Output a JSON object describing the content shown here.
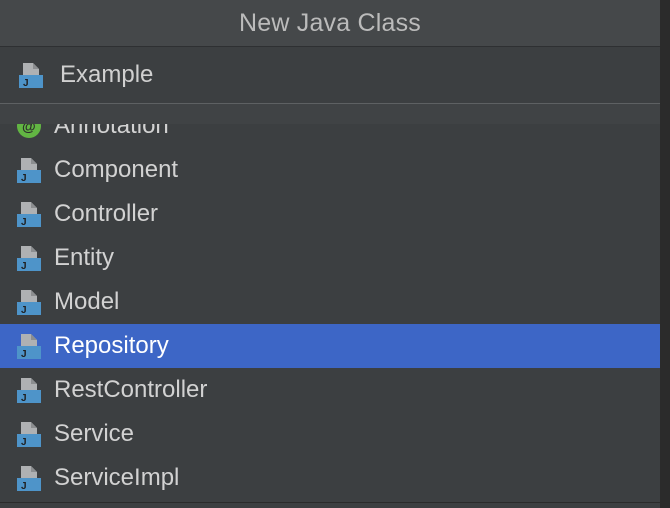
{
  "dialog": {
    "title": "New Java Class"
  },
  "name_field": {
    "value": "Example",
    "icon": "java-class-icon"
  },
  "template_list": {
    "items": [
      {
        "label": "Annotation",
        "icon": "annotation-icon",
        "selected": false
      },
      {
        "label": "Component",
        "icon": "java-class-icon",
        "selected": false
      },
      {
        "label": "Controller",
        "icon": "java-class-icon",
        "selected": false
      },
      {
        "label": "Entity",
        "icon": "java-class-icon",
        "selected": false
      },
      {
        "label": "Model",
        "icon": "java-class-icon",
        "selected": false
      },
      {
        "label": "Repository",
        "icon": "java-class-icon",
        "selected": true
      },
      {
        "label": "RestController",
        "icon": "java-class-icon",
        "selected": false
      },
      {
        "label": "Service",
        "icon": "java-class-icon",
        "selected": false
      },
      {
        "label": "ServiceImpl",
        "icon": "java-class-icon",
        "selected": false
      }
    ]
  },
  "colors": {
    "background": "#3c3f41",
    "selection": "#3d66c6",
    "icon_blue": "#4e94c9",
    "icon_gray": "#afb1b3",
    "annotation_green": "#62b543"
  }
}
